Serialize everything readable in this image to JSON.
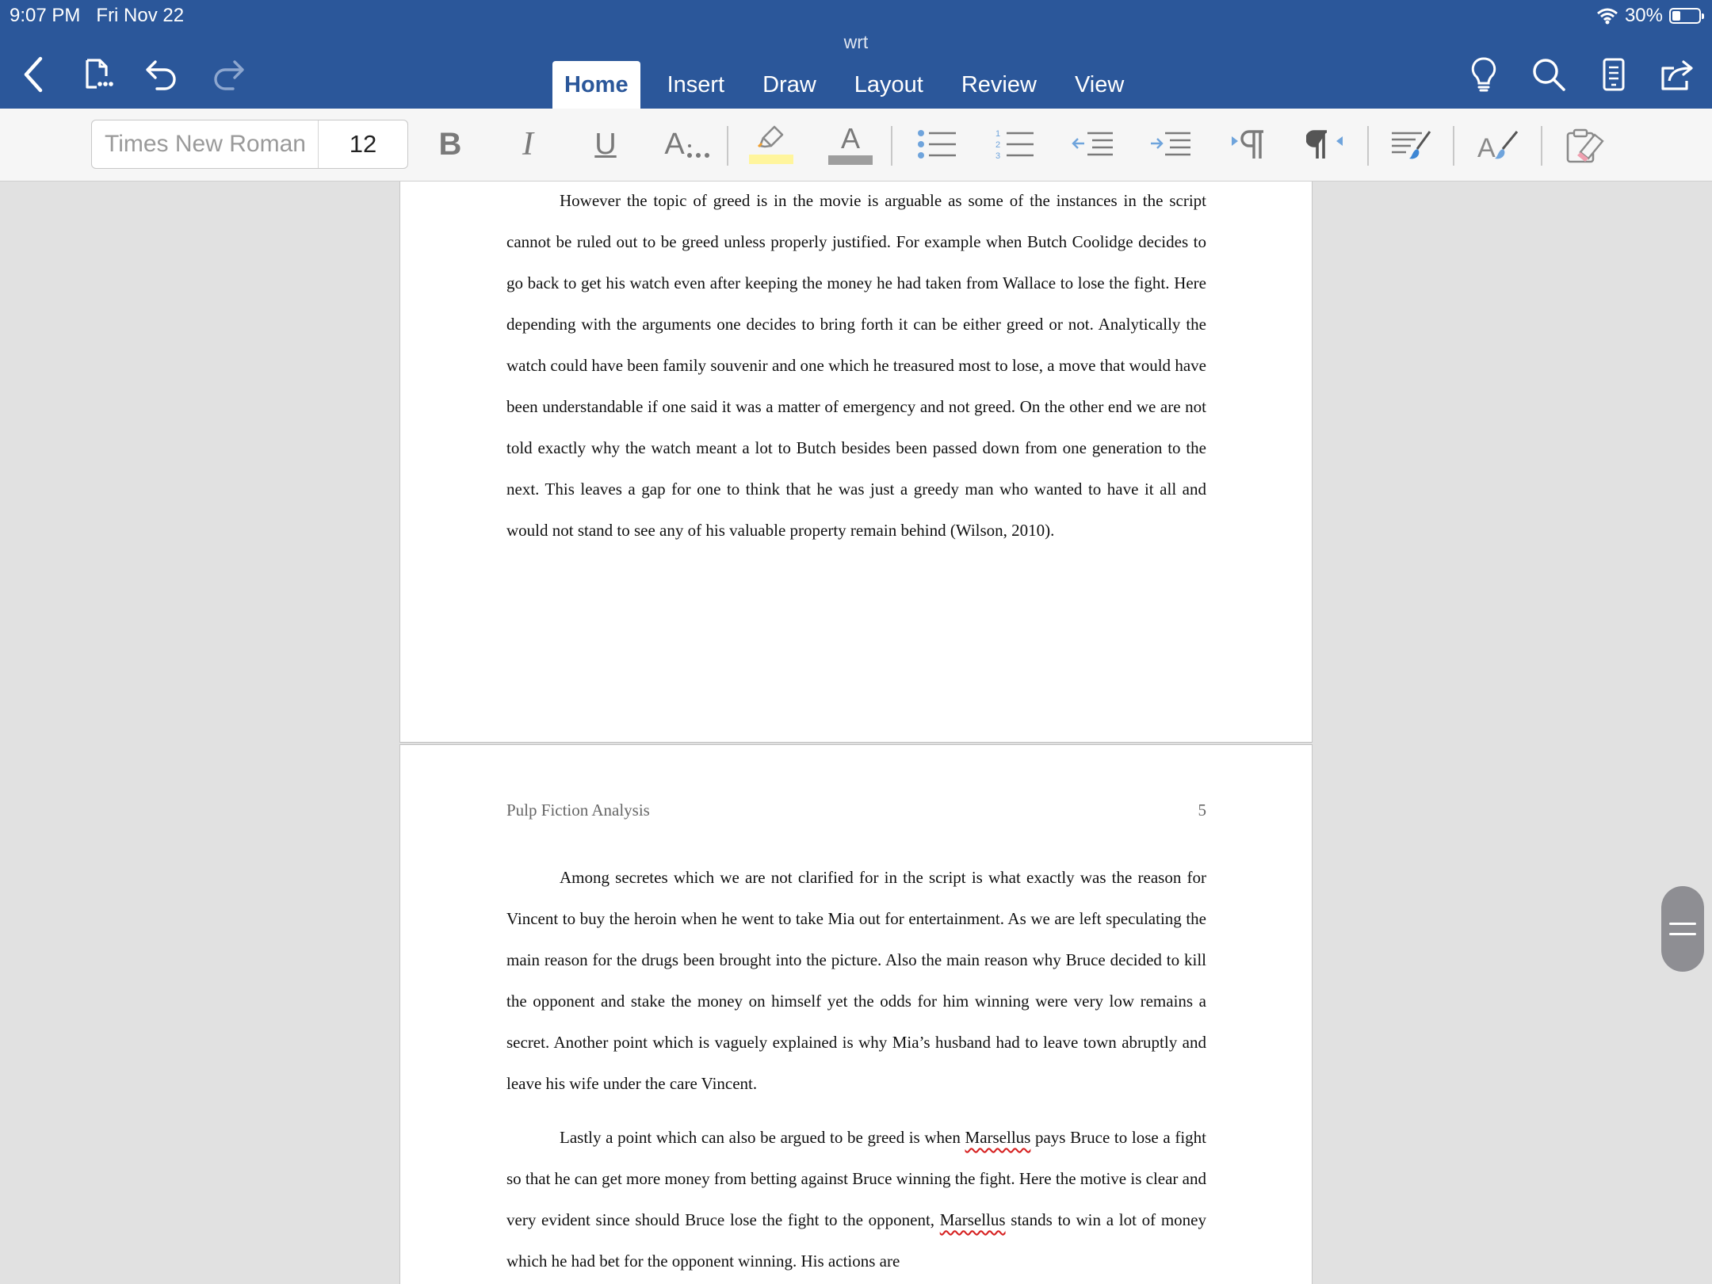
{
  "status_bar": {
    "time": "9:07 PM",
    "date": "Fri Nov 22",
    "battery": "30%",
    "battery_level": 0.3
  },
  "document_title": "wrt",
  "nav": {
    "back_icon": "chevron-left-icon",
    "file_icon": "file-menu-icon",
    "undo_icon": "undo-icon",
    "redo_icon": "redo-icon",
    "right_icons": [
      "lightbulb-icon",
      "search-icon",
      "mobile-view-icon",
      "share-icon"
    ]
  },
  "tabs": [
    {
      "label": "Home",
      "active": true
    },
    {
      "label": "Insert"
    },
    {
      "label": "Draw"
    },
    {
      "label": "Layout"
    },
    {
      "label": "Review"
    },
    {
      "label": "View"
    }
  ],
  "ribbon": {
    "font_name": "Times New Roman",
    "font_size": "12",
    "bold": "B",
    "italic": "I",
    "underline": "U",
    "more_font": "A",
    "font_color_letter": "A",
    "highlight_color": "#fff59d",
    "font_color": "#9e9e9e"
  },
  "page1": {
    "paragraph": "However the topic of greed is in the movie is arguable as some of the instances in the script cannot be ruled out to be greed unless properly justified. For example when Butch Coolidge decides to go back to get his watch even after keeping the money he had taken from Wallace to lose the fight. Here depending with the arguments one decides to bring forth it can be either greed or not. Analytically the watch could have been family souvenir and one which he treasured most to lose, a move that would have been understandable if one said it was a matter of emergency and not greed. On the other end we are not told exactly why the watch meant a lot to Butch besides been passed down from one generation to the next. This leaves a gap for one to think that he was just a greedy man who wanted to have it all and would not stand to see any of his valuable property remain behind (Wilson, 2010)."
  },
  "page2": {
    "header_title": "Pulp Fiction Analysis",
    "page_number": "5",
    "paragraph1": "Among secretes which we are not clarified for in the script is what exactly was the reason for Vincent to buy the heroin when he went to take Mia out for entertainment. As we are left speculating the main reason for the drugs been brought into the picture. Also the main reason why Bruce decided to kill the opponent and stake the money on himself yet the odds for him winning were very low remains a secret. Another point which is vaguely explained is why Mia’s husband had to leave town abruptly and leave his wife under the care Vincent.",
    "paragraph2": {
      "part1": "Lastly a point which can also be argued to be greed is when ",
      "misspelled1": "Marsellus",
      "part2": " pays Bruce to lose a fight so that he can get more money from betting against Bruce winning the fight. Here the motive is clear and very evident since should Bruce lose the fight to the opponent, ",
      "misspelled2": "Marsellus",
      "part3": " stands to win a lot of money which he had bet for the opponent winning. His actions are"
    }
  }
}
